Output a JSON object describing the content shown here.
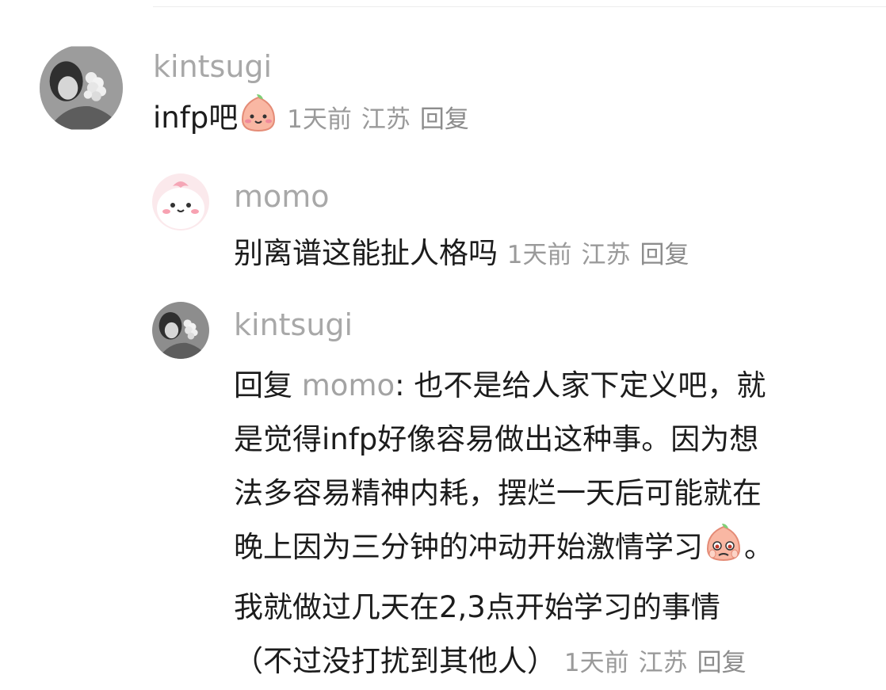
{
  "comments": [
    {
      "username": "kintsugi",
      "text": "infp吧",
      "emoji": "peach-smile-emoji",
      "time": "1天前",
      "location": "江苏",
      "reply_label": "回复"
    },
    {
      "username": "momo",
      "text": "别离谱这能扯人格吗",
      "time": "1天前",
      "location": "江苏",
      "reply_label": "回复"
    },
    {
      "username": "kintsugi",
      "reply_prefix": "回复",
      "mention": "momo",
      "line1": ": 也不是给人家下定义吧，就",
      "line2": "是觉得infp好像容易做出这种事。因为想",
      "line3": "法多容易精神内耗，摆烂一天后可能就在",
      "line4": "晚上因为三分钟的冲动开始激情学习",
      "line4_end": "。",
      "line5": "我就做过几天在2,3点开始学习的事情",
      "line6": "（不过没打扰到其他人）",
      "emoji": "peach-pleading-emoji",
      "time": "1天前",
      "location": "江苏",
      "reply_label": "回复"
    }
  ]
}
